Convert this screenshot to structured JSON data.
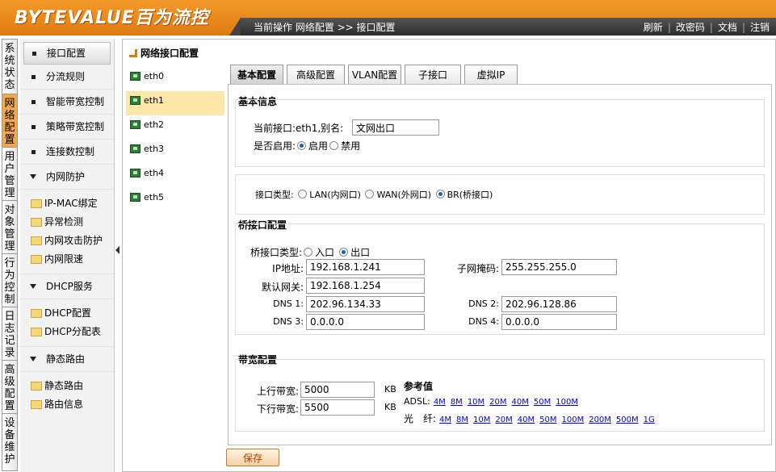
{
  "header": {
    "logo": "BYTEVALUE百为流控",
    "breadcrumb": "当前操作 网络配置 >> 接口配置",
    "links": [
      "刷新",
      "改密码",
      "文档",
      "注销"
    ]
  },
  "vtabs": [
    "系统状态",
    "网络配置",
    "用户管理",
    "对象管理",
    "行为控制",
    "日志记录",
    "高级配置",
    "设备维护"
  ],
  "menu": {
    "items": [
      "接口配置",
      "分流规则",
      "智能带宽控制",
      "策略带宽控制",
      "连接数控制"
    ],
    "groups": [
      {
        "label": "内网防护",
        "subs": [
          "IP-MAC绑定",
          "异常检测",
          "内网攻击防护",
          "内网限速"
        ]
      },
      {
        "label": "DHCP服务",
        "subs": [
          "DHCP配置",
          "DHCP分配表"
        ]
      },
      {
        "label": "静态路由",
        "subs": [
          "静态路由",
          "路由信息"
        ]
      }
    ]
  },
  "panel_title": "网络接口配置",
  "interfaces": [
    "eth0",
    "eth1",
    "eth2",
    "eth3",
    "eth4",
    "eth5"
  ],
  "tabs": [
    "基本配置",
    "高级配置",
    "VLAN配置",
    "子接口",
    "虚拟IP"
  ],
  "basic": {
    "head": "基本信息",
    "current_label": "当前接口:eth1,别名:",
    "alias": "文网出口",
    "enable_label": "是否启用:",
    "enable_on": "启用",
    "enable_off": "禁用"
  },
  "iftype": {
    "label": "接口类型:",
    "lan": "LAN(内网口)",
    "wan": "WAN(外网口)",
    "br": "BR(桥接口)"
  },
  "bridge": {
    "head": "桥接口配置",
    "type_label": "桥接口类型:",
    "in": "入口",
    "out": "出口",
    "ip_label": "IP地址:",
    "ip": "192.168.1.241",
    "mask_label": "子网掩码:",
    "mask": "255.255.255.0",
    "gw_label": "默认网关:",
    "gw": "192.168.1.254",
    "dns1_label": "DNS 1:",
    "dns1": "202.96.134.33",
    "dns2_label": "DNS 2:",
    "dns2": "202.96.128.86",
    "dns3_label": "DNS 3:",
    "dns3": "0.0.0.0",
    "dns4_label": "DNS 4:",
    "dns4": "0.0.0.0"
  },
  "bandwidth": {
    "head": "带宽配置",
    "up_label": "上行带宽:",
    "up": "5000",
    "down_label": "下行带宽:",
    "down": "5500",
    "unit": "KB",
    "ref_head": "参考值",
    "adsl_label": "ADSL:",
    "adsl": [
      "4M",
      "8M",
      "10M",
      "20M",
      "40M",
      "50M",
      "100M"
    ],
    "fiber_label": "光　纤:",
    "fiber": [
      "4M",
      "8M",
      "10M",
      "20M",
      "40M",
      "50M",
      "100M",
      "200M",
      "500M",
      "1G"
    ]
  },
  "save_label": "保存"
}
